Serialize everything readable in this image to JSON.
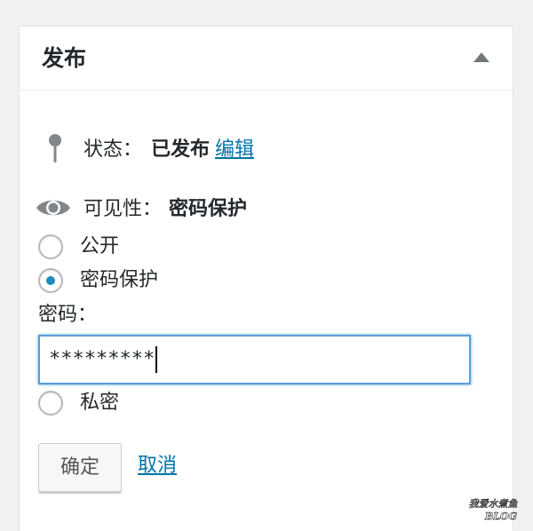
{
  "publish_box": {
    "title": "发布",
    "toggle_icon": "triangle-up-icon",
    "status": {
      "icon": "pin-icon",
      "label": "状态：",
      "value": "已发布",
      "edit_link": "编辑"
    },
    "visibility": {
      "icon": "eye-icon",
      "label": "可见性：",
      "value": "密码保护",
      "options": [
        {
          "label": "公开",
          "checked": false
        },
        {
          "label": "密码保护",
          "checked": true
        },
        {
          "label": "私密",
          "checked": false
        }
      ],
      "password_label": "密码：",
      "password_value": "*********"
    },
    "ok_button": "确定",
    "cancel_link": "取消"
  },
  "watermark": {
    "top_text": "我爱水煮鱼",
    "bottom_text": "BLOG"
  },
  "colors": {
    "accent": "#0073aa",
    "radio_dot": "#1e8cbe",
    "focus_border": "#5b9dd9"
  }
}
